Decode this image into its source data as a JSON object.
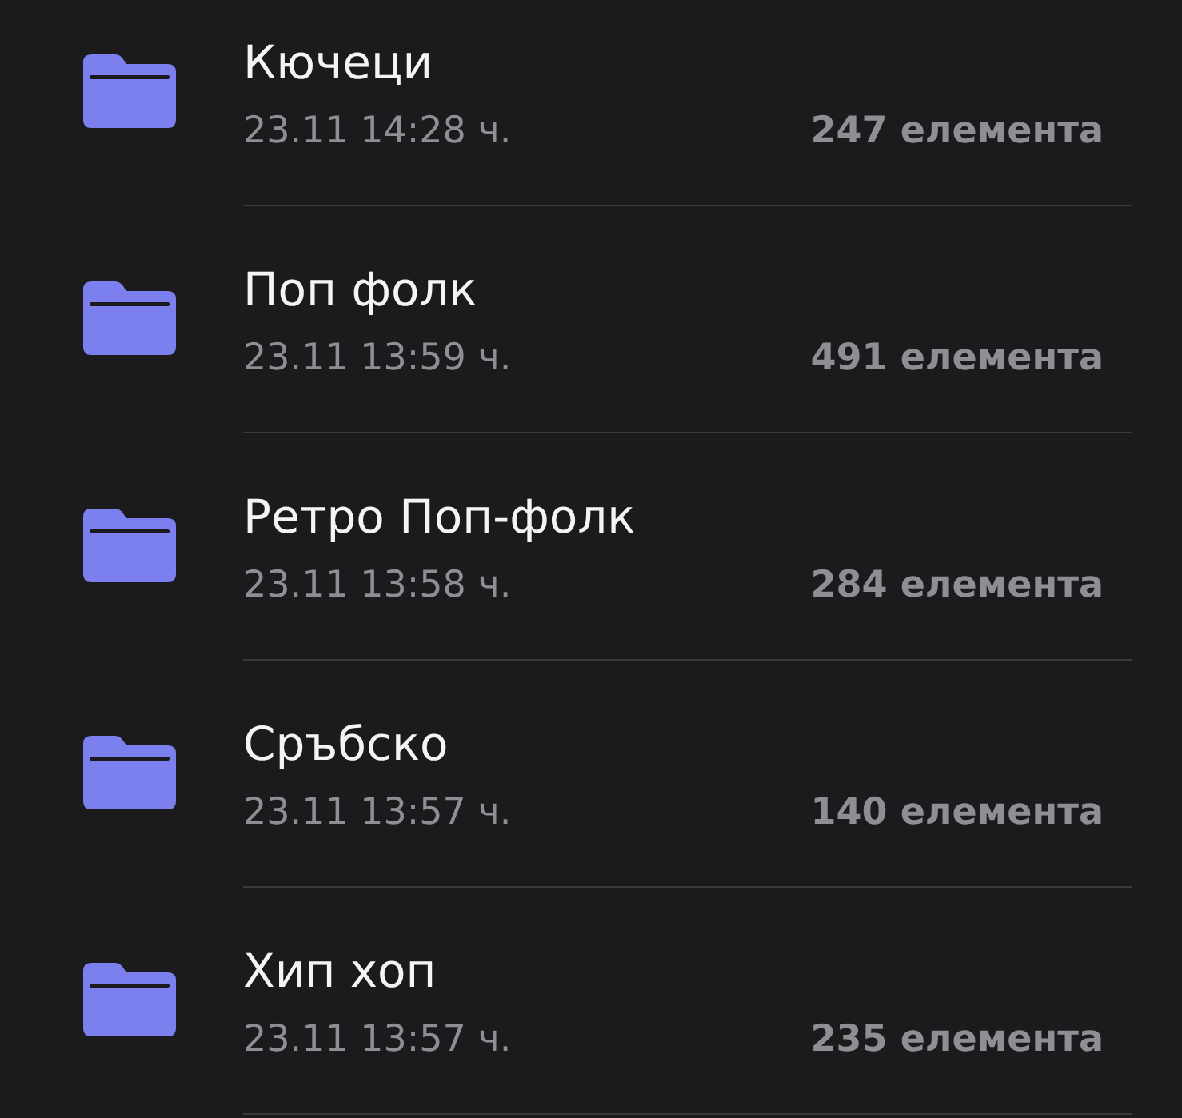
{
  "folders": [
    {
      "name": "Кючеци",
      "date": "23.11 14:28 ч.",
      "count": "247 елемента"
    },
    {
      "name": "Поп фолк",
      "date": "23.11 13:59 ч.",
      "count": "491 елемента"
    },
    {
      "name": "Ретро Поп-фолк",
      "date": "23.11 13:58 ч.",
      "count": "284 елемента"
    },
    {
      "name": "Сръбско",
      "date": "23.11 13:57 ч.",
      "count": "140 елемента"
    },
    {
      "name": "Хип хоп",
      "date": "23.11 13:57 ч.",
      "count": "235 елемента"
    }
  ]
}
